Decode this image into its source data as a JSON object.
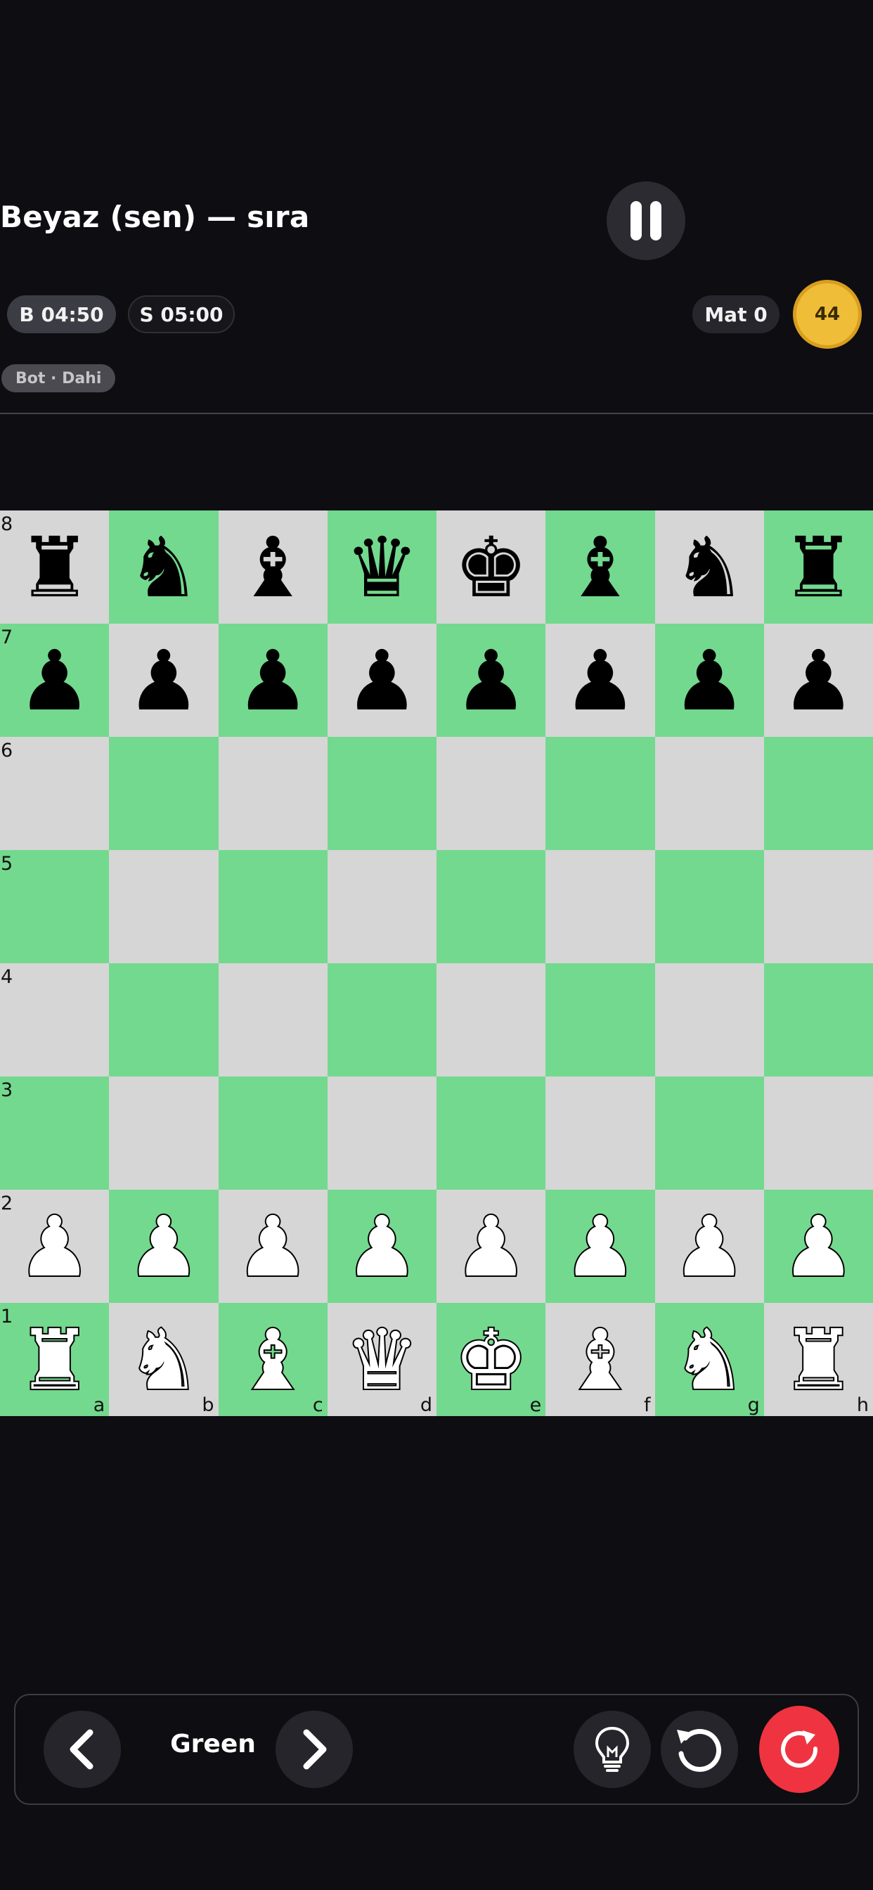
{
  "header": {
    "turn_text": "Beyaz (sen) — sıra",
    "white_clock": "B 04:50",
    "black_clock": "S 05:00",
    "mate_label": "Mat 0",
    "coins": "44",
    "bot_badge": "Bot · Dahi"
  },
  "board": {
    "ranks": [
      "8",
      "7",
      "6",
      "5",
      "4",
      "3",
      "2",
      "1"
    ],
    "files": [
      "a",
      "b",
      "c",
      "d",
      "e",
      "f",
      "g",
      "h"
    ],
    "rows": [
      [
        "♚r",
        "♚n",
        "♚b",
        "♚q",
        "♚k",
        "♚b",
        "♚n",
        "♚r"
      ],
      [
        "♚p",
        "♚p",
        "♚p",
        "♚p",
        "♚p",
        "♚p",
        "♚p",
        "♚p"
      ],
      [
        "",
        "",
        "",
        "",
        "",
        "",
        "",
        ""
      ],
      [
        "",
        "",
        "",
        "",
        "",
        "",
        "",
        ""
      ],
      [
        "",
        "",
        "",
        "",
        "",
        "",
        "",
        ""
      ],
      [
        "",
        "",
        "",
        "",
        "",
        "",
        "",
        ""
      ],
      [
        "♔P",
        "♔P",
        "♔P",
        "♔P",
        "♔P",
        "♔P",
        "♔P",
        "♔P"
      ],
      [
        "♔R",
        "♔N",
        "♔B",
        "♔Q",
        "♔K",
        "♔B",
        "♔N",
        "♔R"
      ]
    ]
  },
  "controls": {
    "theme_name": "Green"
  },
  "colors": {
    "light_square": "#d6d6d6",
    "dark_square": "#73d98e",
    "coin": "#f0bd38",
    "restart": "#ef3340"
  }
}
